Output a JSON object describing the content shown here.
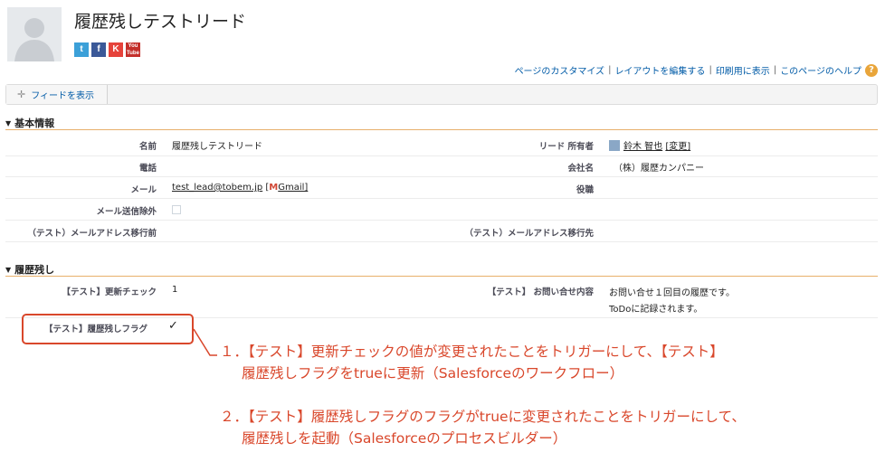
{
  "header": {
    "title": "履歴残しテストリード",
    "social": [
      "twitter",
      "facebook",
      "klout",
      "youtube"
    ],
    "youtube_label": "You Tube"
  },
  "help_links": [
    "ページのカスタマイズ",
    "レイアウトを編集する",
    "印刷用に表示",
    "このページのヘルプ"
  ],
  "help_icon": "?",
  "feed_button": "フィードを表示",
  "sections": {
    "basic": {
      "title": "基本情報",
      "rows": {
        "name_label": "名前",
        "name_value": "履歴残しテストリード",
        "owner_label": "リード 所有者",
        "owner_name": "鈴木 智也",
        "owner_change": "[変更]",
        "phone_label": "電話",
        "company_label": "会社名",
        "company_value": "（株）履歴カンパニー",
        "email_label": "メール",
        "email_value": "test_lead@tobem.jp",
        "gmail_open": "[",
        "gmail_label": "Gmail]",
        "title_label": "役職",
        "optout_label": "メール送信除外",
        "migrate_from_label": "（テスト）メールアドレス移行前",
        "migrate_to_label": "（テスト）メールアドレス移行先"
      }
    },
    "history": {
      "title": "履歴残し",
      "rows": {
        "update_check_label": "【テスト】更新チェック",
        "update_check_value": "1",
        "inquiry_label": "【テスト】 お問い合せ内容",
        "inquiry_line1": "お問い合せ１回目の履歴です。",
        "inquiry_line2": "ToDoに記録されます。",
        "flag_label": "【テスト】履歴残しフラグ",
        "flag_value": "✓"
      }
    }
  },
  "annotations": {
    "item1_line1": "１．【テスト】更新チェックの値が変更されたことをトリガーにして、【テスト】",
    "item1_line2": "履歴残しフラグをtrueに更新（Salesforceのワークフロー）",
    "item2_line1": "２．【テスト】履歴残しフラグのフラグがtrueに変更されたことをトリガーにして、",
    "item2_line2": "履歴残しを起動（Salesforceのプロセスビルダー）"
  },
  "colors": {
    "link": "#015ba7",
    "annotation": "#d9472b",
    "section_rule": "#e8b06b"
  }
}
